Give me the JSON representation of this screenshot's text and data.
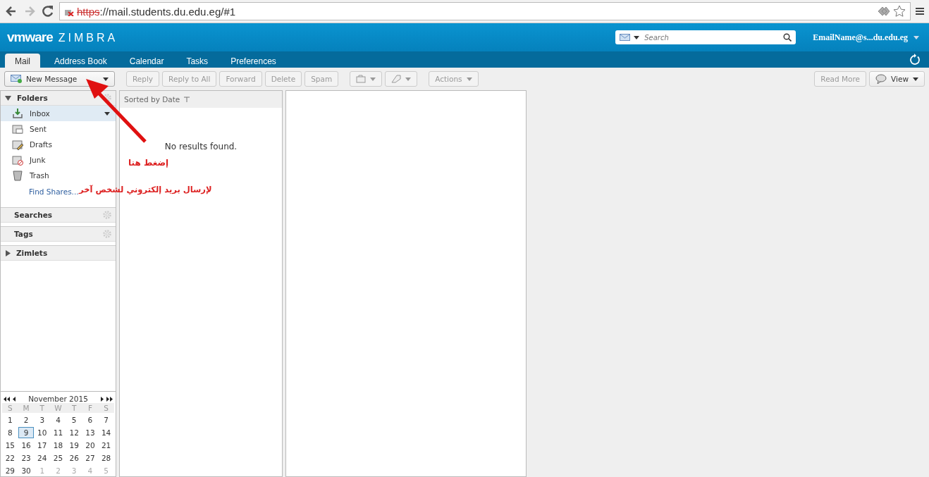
{
  "browser": {
    "url_scheme": "https",
    "url_rest": "://mail.students.du.edu.eg/#1"
  },
  "header": {
    "logo_brand": "vmware",
    "logo_product": "ZIMBRA",
    "search": {
      "placeholder": "Search"
    },
    "user": "EmailName@s...du.edu.eg"
  },
  "tabs": [
    {
      "label": "Mail",
      "selected": true
    },
    {
      "label": "Address Book",
      "selected": false
    },
    {
      "label": "Calendar",
      "selected": false
    },
    {
      "label": "Tasks",
      "selected": false
    },
    {
      "label": "Preferences",
      "selected": false
    }
  ],
  "toolbar": [
    {
      "kind": "new",
      "label": "New Message",
      "disabled": false
    },
    {
      "kind": "text",
      "label": "Reply",
      "disabled": true
    },
    {
      "kind": "text",
      "label": "Reply to All",
      "disabled": true
    },
    {
      "kind": "text",
      "label": "Forward",
      "disabled": true
    },
    {
      "kind": "text",
      "label": "Delete",
      "disabled": true
    },
    {
      "kind": "text",
      "label": "Spam",
      "disabled": true
    },
    {
      "kind": "move",
      "disabled": true
    },
    {
      "kind": "tag",
      "disabled": true
    },
    {
      "kind": "menu",
      "label": "Actions",
      "disabled": true
    }
  ],
  "toolbar_right": [
    {
      "kind": "text",
      "label": "Read More",
      "disabled": true
    },
    {
      "kind": "view",
      "label": "View",
      "disabled": false
    }
  ],
  "folders": {
    "title": "Folders",
    "expanded": true,
    "items": [
      {
        "kind": "inbox",
        "label": "Inbox",
        "selected": true
      },
      {
        "kind": "sent",
        "label": "Sent",
        "selected": false
      },
      {
        "kind": "drafts",
        "label": "Drafts",
        "selected": false
      },
      {
        "kind": "junk",
        "label": "Junk",
        "selected": false
      },
      {
        "kind": "trash",
        "label": "Trash",
        "selected": false
      }
    ],
    "find_shares": "Find Shares..."
  },
  "sections": [
    {
      "kind": "gear",
      "title": "Searches"
    },
    {
      "kind": "gear",
      "title": "Tags"
    },
    {
      "kind": "collapsed",
      "title": "Zimlets"
    }
  ],
  "message_list": {
    "sort_label": "Sorted by Date",
    "empty_text": "No results found."
  },
  "annotation": {
    "line_1": "إضغط هنا",
    "line_2": "لإرسال بريد إلكتروني لشخص آخر"
  },
  "mini_calendar": {
    "month": "November 2015",
    "weekdays": [
      "S",
      "M",
      "T",
      "W",
      "T",
      "F",
      "S"
    ],
    "weeks": [
      [
        {
          "d": "1",
          "other": false,
          "selected": false
        },
        {
          "d": "2",
          "other": false,
          "selected": false
        },
        {
          "d": "3",
          "other": false,
          "selected": false
        },
        {
          "d": "4",
          "other": false,
          "selected": false
        },
        {
          "d": "5",
          "other": false,
          "selected": false
        },
        {
          "d": "6",
          "other": false,
          "selected": false
        },
        {
          "d": "7",
          "other": false,
          "selected": false
        }
      ],
      [
        {
          "d": "8",
          "other": false,
          "selected": false
        },
        {
          "d": "9",
          "other": false,
          "selected": true
        },
        {
          "d": "10",
          "other": false,
          "selected": false
        },
        {
          "d": "11",
          "other": false,
          "selected": false
        },
        {
          "d": "12",
          "other": false,
          "selected": false
        },
        {
          "d": "13",
          "other": false,
          "selected": false
        },
        {
          "d": "14",
          "other": false,
          "selected": false
        }
      ],
      [
        {
          "d": "15",
          "other": false,
          "selected": false
        },
        {
          "d": "16",
          "other": false,
          "selected": false
        },
        {
          "d": "17",
          "other": false,
          "selected": false
        },
        {
          "d": "18",
          "other": false,
          "selected": false
        },
        {
          "d": "19",
          "other": false,
          "selected": false
        },
        {
          "d": "20",
          "other": false,
          "selected": false
        },
        {
          "d": "21",
          "other": false,
          "selected": false
        }
      ],
      [
        {
          "d": "22",
          "other": false,
          "selected": false
        },
        {
          "d": "23",
          "other": false,
          "selected": false
        },
        {
          "d": "24",
          "other": false,
          "selected": false
        },
        {
          "d": "25",
          "other": false,
          "selected": false
        },
        {
          "d": "26",
          "other": false,
          "selected": false
        },
        {
          "d": "27",
          "other": false,
          "selected": false
        },
        {
          "d": "28",
          "other": false,
          "selected": false
        }
      ],
      [
        {
          "d": "29",
          "other": false,
          "selected": false
        },
        {
          "d": "30",
          "other": false,
          "selected": false
        },
        {
          "d": "1",
          "other": true,
          "selected": false
        },
        {
          "d": "2",
          "other": true,
          "selected": false
        },
        {
          "d": "3",
          "other": true,
          "selected": false
        },
        {
          "d": "4",
          "other": true,
          "selected": false
        },
        {
          "d": "5",
          "other": true,
          "selected": false
        }
      ]
    ]
  }
}
